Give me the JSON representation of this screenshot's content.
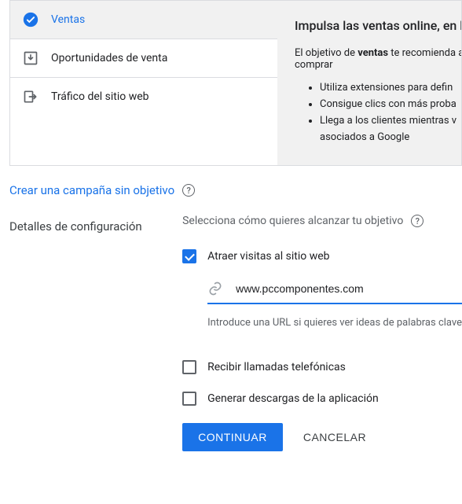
{
  "objectives": {
    "items": [
      {
        "label": "Ventas",
        "selected": true
      },
      {
        "label": "Oportunidades de venta",
        "selected": false
      },
      {
        "label": "Tráfico del sitio web",
        "selected": false
      }
    ]
  },
  "info": {
    "title": "Impulsa las ventas online, en la",
    "desc_pre": "El objetivo de ",
    "desc_bold": "ventas",
    "desc_post": " te recomienda aju",
    "desc_line2": "comprar",
    "bullets": [
      "Utiliza extensiones para defin",
      "Consigue clics con más proba",
      "Llega a los clientes mientras v",
      "asociados a Google"
    ]
  },
  "no_objective": {
    "label": "Crear una campaña sin objetivo"
  },
  "config": {
    "section_label": "Detalles de configuración",
    "subtitle": "Selecciona cómo quieres alcanzar tu objetivo",
    "visits": {
      "label": "Atraer visitas al sitio web",
      "checked": true,
      "url": "www.pccomponentes.com",
      "hint": "Introduce una URL si quieres ver ideas de palabras clave"
    },
    "calls": {
      "label": "Recibir llamadas telefónicas",
      "checked": false
    },
    "downloads": {
      "label": "Generar descargas de la aplicación",
      "checked": false
    }
  },
  "buttons": {
    "continue": "CONTINUAR",
    "cancel": "CANCELAR"
  }
}
